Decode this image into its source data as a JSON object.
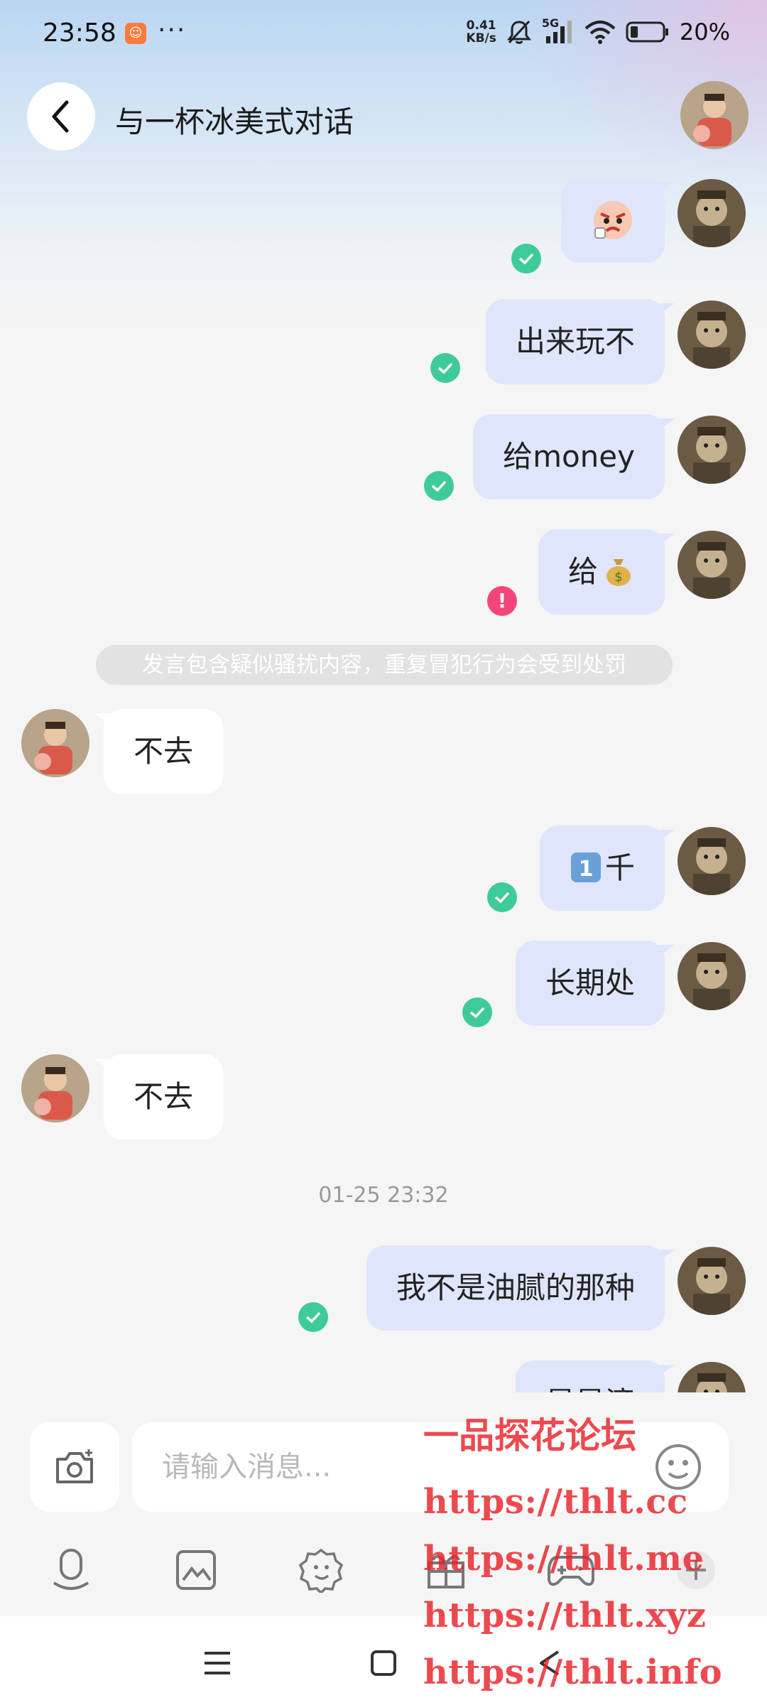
{
  "status_bar": {
    "time": "23:58",
    "more": "···",
    "net_speed_value": "0.41",
    "net_speed_unit": "KB/s",
    "signal_label": "5G",
    "battery": "20%"
  },
  "header": {
    "title": "与一杯冰美式对话"
  },
  "messages": [
    {
      "side": "me",
      "text": "",
      "emoji": "angry-face-sticker",
      "status": "sent"
    },
    {
      "side": "me",
      "text": "出来玩不",
      "status": "sent"
    },
    {
      "side": "me",
      "text": "给money",
      "status": "sent"
    },
    {
      "side": "me",
      "text": "给",
      "emoji": "money-bag",
      "status": "failed"
    },
    {
      "side": "peer",
      "text": "不去"
    },
    {
      "side": "me",
      "text": "千",
      "emoji": "keycap-one",
      "status": "sent"
    },
    {
      "side": "me",
      "text": "长期处",
      "status": "sent"
    },
    {
      "side": "peer",
      "text": "不去"
    },
    {
      "side": "me",
      "text": "我不是油腻的那种",
      "status": "sent"
    },
    {
      "side": "me",
      "text": "是是滴",
      "status": "sent"
    }
  ],
  "system_notice": "发言包含疑似骚扰内容，重复冒犯行为会受到处罚",
  "timestamp": "01-25 23:32",
  "input": {
    "placeholder": "请输入消息..."
  },
  "toolbar": {
    "items": [
      "voice-icon",
      "image-icon",
      "sticker-icon",
      "gift-icon",
      "game-icon",
      "plus-icon"
    ]
  },
  "watermark": {
    "title": "一品探花论坛",
    "urls": [
      "https://thlt.cc",
      "https://thlt.me",
      "https://thlt.xyz",
      "https://thlt.info"
    ]
  },
  "colors": {
    "my_bubble": "#dfe6fb",
    "peer_bubble": "#ffffff",
    "sent_check": "#3fcb99",
    "failed_alert": "#f2467a",
    "watermark": "#e82228"
  }
}
